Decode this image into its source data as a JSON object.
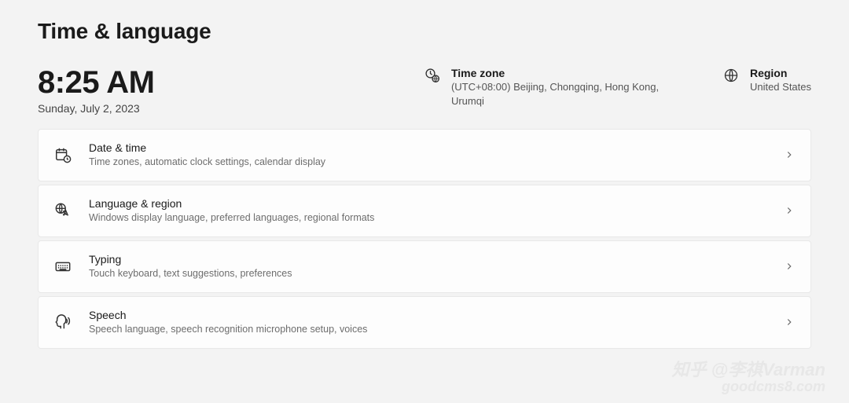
{
  "header": {
    "title": "Time & language"
  },
  "clock": {
    "time": "8:25 AM",
    "date": "Sunday, July 2, 2023"
  },
  "info": {
    "timezone": {
      "title": "Time zone",
      "value": "(UTC+08:00) Beijing, Chongqing, Hong Kong, Urumqi"
    },
    "region": {
      "title": "Region",
      "value": "United States"
    }
  },
  "cards": {
    "datetime": {
      "title": "Date & time",
      "sub": "Time zones, automatic clock settings, calendar display"
    },
    "language": {
      "title": "Language & region",
      "sub": "Windows display language, preferred languages, regional formats"
    },
    "typing": {
      "title": "Typing",
      "sub": "Touch keyboard, text suggestions, preferences"
    },
    "speech": {
      "title": "Speech",
      "sub": "Speech language, speech recognition microphone setup, voices"
    }
  },
  "watermark": {
    "line1": "知乎 @李祺Varman",
    "line2": "goodcms8.com"
  }
}
